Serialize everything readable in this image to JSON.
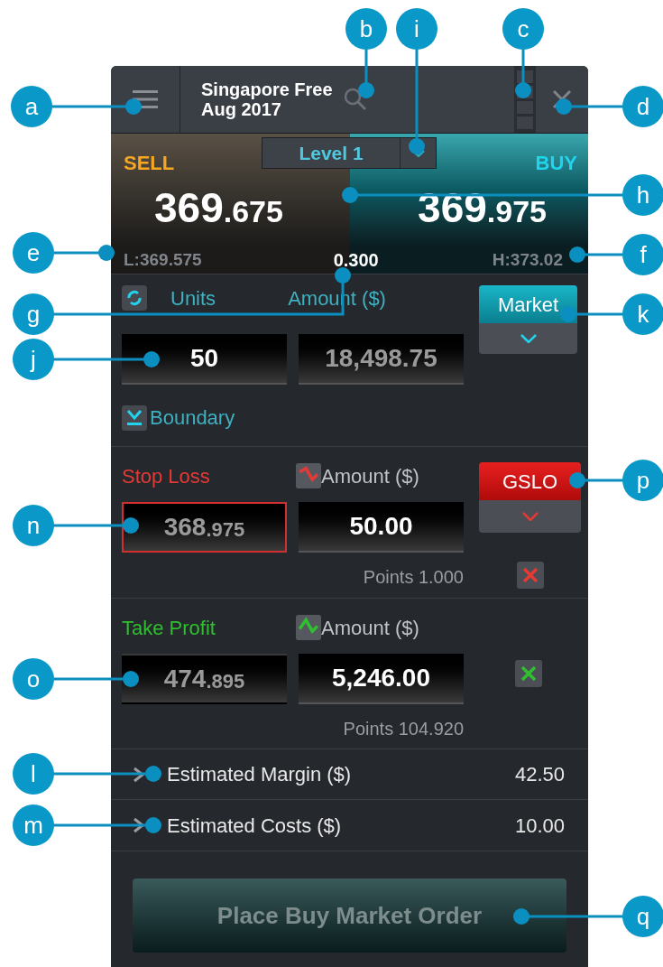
{
  "header": {
    "title_line1": "Singapore Free",
    "title_line2": "Aug 2017"
  },
  "level_selector": {
    "label": "Level 1"
  },
  "sell": {
    "label": "SELL",
    "price_big": "369",
    "price_small": ".675",
    "low": "L:369.575"
  },
  "buy": {
    "label": "BUY",
    "price_big": "369",
    "price_small": ".975",
    "high": "H:373.02"
  },
  "spread": "0.300",
  "order": {
    "units_label": "Units",
    "amount_label": "Amount ($)",
    "units_value": "50",
    "amount_value": "18,498.75",
    "order_type": "Market",
    "boundary_label": "Boundary"
  },
  "limits": [
    {
      "kind": "stop_loss",
      "label": "Stop Loss",
      "amount_label": "Amount ($)",
      "level_big": "368",
      "level_small": ".975",
      "amount_value": "50.00",
      "points": "Points 1.000",
      "type": "GSLO",
      "focused": true
    },
    {
      "kind": "take_profit",
      "label": "Take Profit",
      "amount_label": "Amount ($)",
      "level_big": "474",
      "level_small": ".895",
      "amount_value": "5,246.00",
      "points": "Points 104.920",
      "focused": false
    }
  ],
  "estimates": [
    {
      "label": "Estimated Margin ($)",
      "value": "42.50"
    },
    {
      "label": "Estimated Costs ($)",
      "value": "10.00"
    }
  ],
  "submit": {
    "label": "Place Buy Market Order",
    "disabled": true
  },
  "callouts": [
    {
      "letter": "b"
    },
    {
      "letter": "i"
    },
    {
      "letter": "c"
    },
    {
      "letter": "a"
    },
    {
      "letter": "d"
    },
    {
      "letter": "h"
    },
    {
      "letter": "e"
    },
    {
      "letter": "f"
    },
    {
      "letter": "g"
    },
    {
      "letter": "k"
    },
    {
      "letter": "j"
    },
    {
      "letter": "p"
    },
    {
      "letter": "n"
    },
    {
      "letter": "o"
    },
    {
      "letter": "l"
    },
    {
      "letter": "m"
    },
    {
      "letter": "q"
    }
  ]
}
